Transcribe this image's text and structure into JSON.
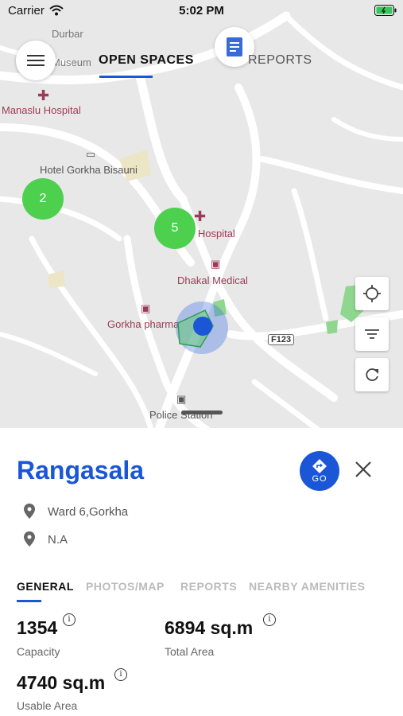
{
  "status_bar": {
    "carrier": "Carrier",
    "time": "5:02 PM"
  },
  "map": {
    "labels": {
      "durbar_line1": "Durbar",
      "durbar_line2": "Museum",
      "manaslu": "Manaslu Hospital",
      "hotel": "Hotel Gorkha Bisauni",
      "hospital": "e Hospital",
      "dhakal": "Dhakal Medical",
      "pharma": "Gorkha pharma",
      "road": "F123",
      "police": "Police Station"
    },
    "clusters": [
      "2",
      "5"
    ]
  },
  "top_tabs": {
    "open_spaces": "OPEN SPACES",
    "reports": "REPORTS"
  },
  "place": {
    "name": "Rangasala",
    "go_label": "GO",
    "ward": "Ward 6,Gorkha",
    "extra": "N.A"
  },
  "detail_tabs": [
    "GENERAL",
    "PHOTOS/MAP",
    "REPORTS",
    "NEARBY AMENITIES"
  ],
  "stats": {
    "capacity": {
      "value": "1354",
      "label": "Capacity"
    },
    "total_area": {
      "value": "6894 sq.m",
      "label": "Total Area"
    },
    "usable_area": {
      "value": "4740 sq.m",
      "label": "Usable Area"
    }
  },
  "colors": {
    "accent": "#1a56d6",
    "cluster": "#4cd04e",
    "poi": "#9b3b55"
  }
}
